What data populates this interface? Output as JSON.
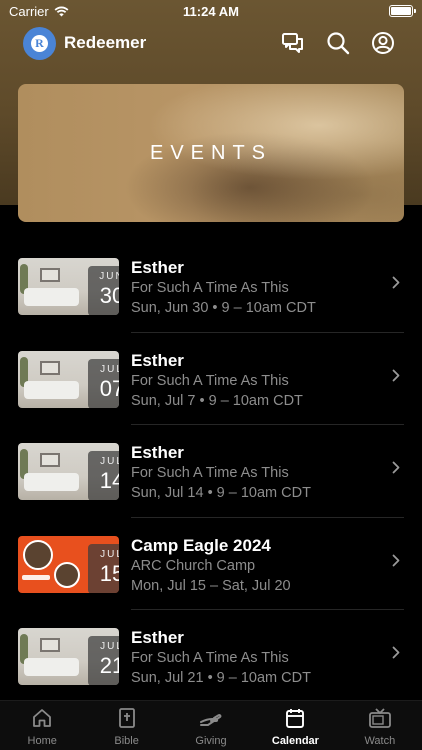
{
  "status_bar": {
    "carrier": "Carrier",
    "time": "11:24 AM"
  },
  "header": {
    "app_name": "Redeemer",
    "logo_letter": "R"
  },
  "banner": {
    "title": "EVENTS"
  },
  "events": [
    {
      "title": "Esther",
      "subtitle": "For Such A Time As This",
      "when": "Sun, Jun 30 • 9 – 10am CDT",
      "month": "JUN",
      "day": "30",
      "thumb": "room"
    },
    {
      "title": "Esther",
      "subtitle": "For Such A Time As This",
      "when": "Sun, Jul 7 • 9 – 10am CDT",
      "month": "JUL",
      "day": "07",
      "thumb": "room"
    },
    {
      "title": "Esther",
      "subtitle": "For Such A Time As This",
      "when": "Sun, Jul 14 • 9 – 10am CDT",
      "month": "JUL",
      "day": "14",
      "thumb": "room"
    },
    {
      "title": "Camp Eagle 2024",
      "subtitle": "ARC Church Camp",
      "when": "Mon, Jul 15 – Sat, Jul 20",
      "month": "JUL",
      "day": "15",
      "thumb": "camp"
    },
    {
      "title": "Esther",
      "subtitle": "For Such A Time As This",
      "when": "Sun, Jul 21 • 9 – 10am CDT",
      "month": "JUL",
      "day": "21",
      "thumb": "room"
    }
  ],
  "tabs": [
    {
      "label": "Home",
      "icon": "home-icon",
      "active": false
    },
    {
      "label": "Bible",
      "icon": "bible-icon",
      "active": false
    },
    {
      "label": "Giving",
      "icon": "giving-icon",
      "active": false
    },
    {
      "label": "Calendar",
      "icon": "calendar-icon",
      "active": true
    },
    {
      "label": "Watch",
      "icon": "tv-icon",
      "active": false
    }
  ],
  "colors": {
    "background": "#000000",
    "header_brown": "#6b5632",
    "logo_blue": "#4a84d6",
    "camp_orange": "#e8501e",
    "muted_text": "#8d8d8d"
  }
}
